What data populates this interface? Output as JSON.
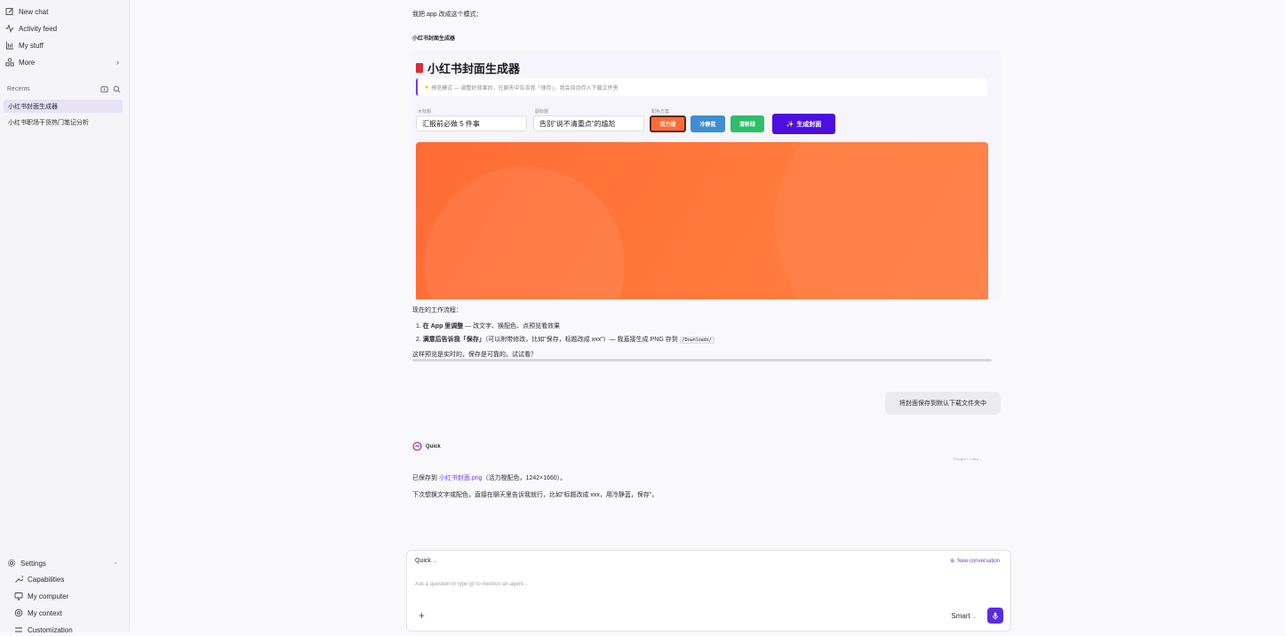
{
  "sidebar": {
    "nav": [
      {
        "label": "New chat",
        "icon": "new-chat-icon"
      },
      {
        "label": "Activity feed",
        "icon": "activity-icon"
      },
      {
        "label": "My stuff",
        "icon": "library-icon"
      },
      {
        "label": "More",
        "icon": "apps-icon"
      }
    ],
    "recents_label": "Recents",
    "recents": [
      "小红书封面生成器",
      "小红书职场干货热门笔记分析"
    ],
    "settings_label": "Settings",
    "settings_items": [
      "Capabilities",
      "My computer",
      "My context",
      "Customization"
    ]
  },
  "chat": {
    "intro": "我把 app 改成这个模式：",
    "app_name_heading": "小红书封面生成器",
    "app": {
      "title": "小红书封面生成器",
      "hint": "预览模式 — 调整好效果后，在聊天中告诉我「保存」，我会自动存入下载文件夹",
      "title_label": "大标题",
      "title_value": "汇报前必做 5 件事",
      "subtitle_label": "副标题",
      "subtitle_value": "告别\"说不清重点\"的尴尬",
      "scheme_label": "配色方案",
      "schemes": [
        {
          "label": "活力橙",
          "color": "#ff6b35"
        },
        {
          "label": "冷静蓝",
          "color": "#3e8ed0"
        },
        {
          "label": "清新绿",
          "color": "#2fbd6a"
        }
      ],
      "generate_label": "生成封面"
    },
    "workflow_title": "现在的工作流程：",
    "steps": [
      {
        "num": "1.",
        "bold": "在 App 里调整",
        "rest": " — 改文字、换配色、点预览看效果"
      },
      {
        "num": "2.",
        "bold": "满意后告诉我「保存」",
        "rest": "（可以附带修改，比如\"保存，标题改成 xxx\"）— 我直接生成 PNG 存到 ",
        "code": "/Downloads/"
      }
    ],
    "closing": "这样预览是实时的，保存是可靠的。试试看？",
    "user_message": "将封面保存到默认下载文件夹中",
    "agent_name": "Quick",
    "thought_label": "Thought • 1 step",
    "reply_prefix": "已保存到 ",
    "reply_link": "小红书封面.png",
    "reply_suffix": "（活力橙配色，1242×1660）。",
    "reply_line2": "下次想换文字或配色，直接在聊天里告诉我就行，比如\"标题改成 xxx，用冷静蓝，保存\"。"
  },
  "composer": {
    "agent": "Quick",
    "new_conversation": "New conversation",
    "placeholder": "Ask a question or type @ to mention an agent...",
    "mode": "Smart"
  }
}
